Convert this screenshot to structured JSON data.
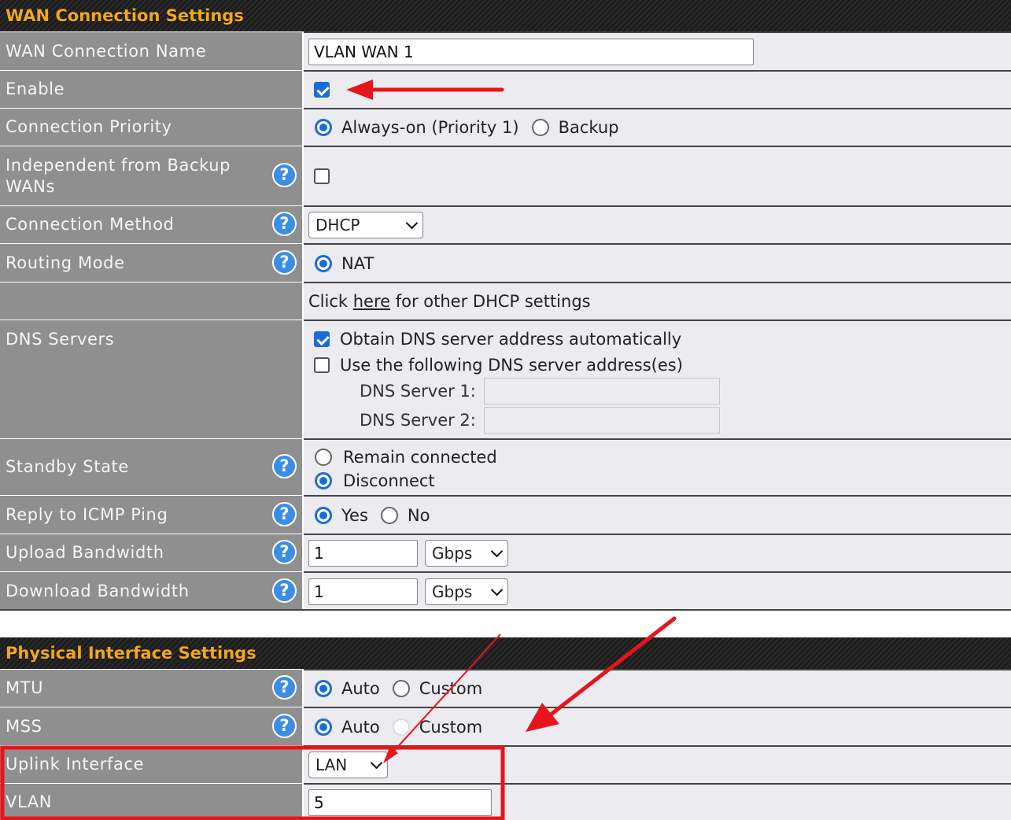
{
  "wan_section": {
    "title": "WAN Connection Settings",
    "connection_name": {
      "label": "WAN Connection Name",
      "value": "VLAN WAN 1"
    },
    "enable": {
      "label": "Enable",
      "checked": true
    },
    "priority": {
      "label": "Connection Priority",
      "options": [
        "Always-on (Priority 1)",
        "Backup"
      ],
      "selected": "Always-on (Priority 1)"
    },
    "independent": {
      "label": "Independent from Backup WANs",
      "checked": false
    },
    "method": {
      "label": "Connection Method",
      "value": "DHCP"
    },
    "routing": {
      "label": "Routing Mode",
      "option": "NAT"
    },
    "dhcp_link": {
      "prefix": "Click ",
      "link": "here",
      "suffix": " for other DHCP settings"
    },
    "dns": {
      "label": "DNS Servers",
      "auto_label": "Obtain DNS server address automatically",
      "auto_checked": true,
      "manual_label": "Use the following DNS server address(es)",
      "manual_checked": false,
      "server1_label": "DNS Server 1:",
      "server2_label": "DNS Server 2:"
    },
    "standby": {
      "label": "Standby State",
      "options": [
        "Remain connected",
        "Disconnect"
      ],
      "selected": "Disconnect"
    },
    "icmp": {
      "label": "Reply to ICMP Ping",
      "options": [
        "Yes",
        "No"
      ],
      "selected": "Yes"
    },
    "upload": {
      "label": "Upload Bandwidth",
      "value": "1",
      "unit": "Gbps"
    },
    "download": {
      "label": "Download Bandwidth",
      "value": "1",
      "unit": "Gbps"
    }
  },
  "physical_section": {
    "title": "Physical Interface Settings",
    "mtu": {
      "label": "MTU",
      "options": [
        "Auto",
        "Custom"
      ],
      "selected": "Auto"
    },
    "mss": {
      "label": "MSS",
      "options": [
        "Auto",
        "Custom"
      ],
      "selected": "Auto"
    },
    "uplink": {
      "label": "Uplink Interface",
      "value": "LAN"
    },
    "vlan": {
      "label": "VLAN",
      "value": "5"
    }
  },
  "help_glyph": "?",
  "colors": {
    "header_text": "#f0a81c",
    "accent": "#1a6cdb",
    "annotation": "#e8141c"
  },
  "icons": [
    "help-icon",
    "checkbox-icon",
    "radio-icon",
    "chevron-down-icon",
    "arrow-annotation"
  ]
}
